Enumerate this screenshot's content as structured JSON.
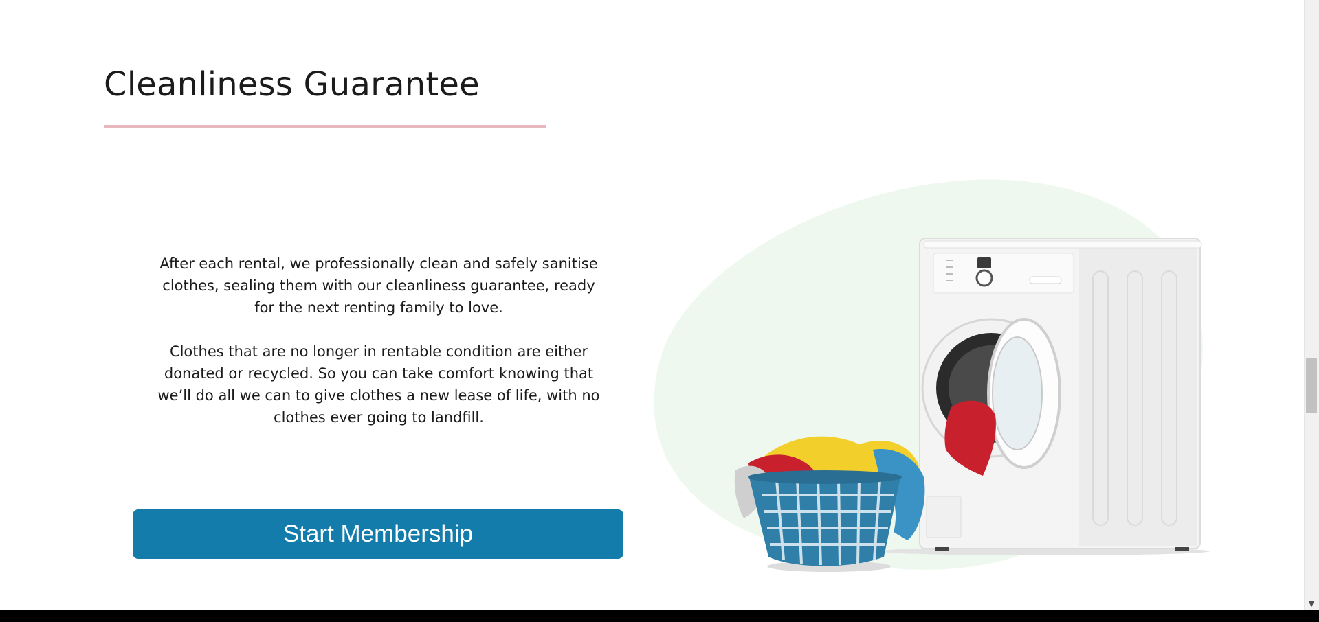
{
  "section": {
    "title": "Cleanliness Guarantee",
    "paragraphs": [
      "After each rental, we professionally clean and safely sanitise clothes, sealing them with our cleanliness guarantee, ready for the next renting family to love.",
      "Clothes that are no longer in rentable condition are either donated or recycled. So you can take comfort knowing that we’ll do all we can to give clothes a new lease of life, with no clothes ever going to landfill."
    ],
    "cta_label": "Start Membership"
  },
  "illustration": {
    "icon": "washing-machine-with-laundry-basket",
    "blob_color": "#eef8ee",
    "machine_color": "#f7f7f7",
    "basket_color": "#2f7fa8"
  },
  "colors": {
    "accent_rule": "#e8b8be",
    "button": "#147caa",
    "text": "#1b1b1b"
  }
}
